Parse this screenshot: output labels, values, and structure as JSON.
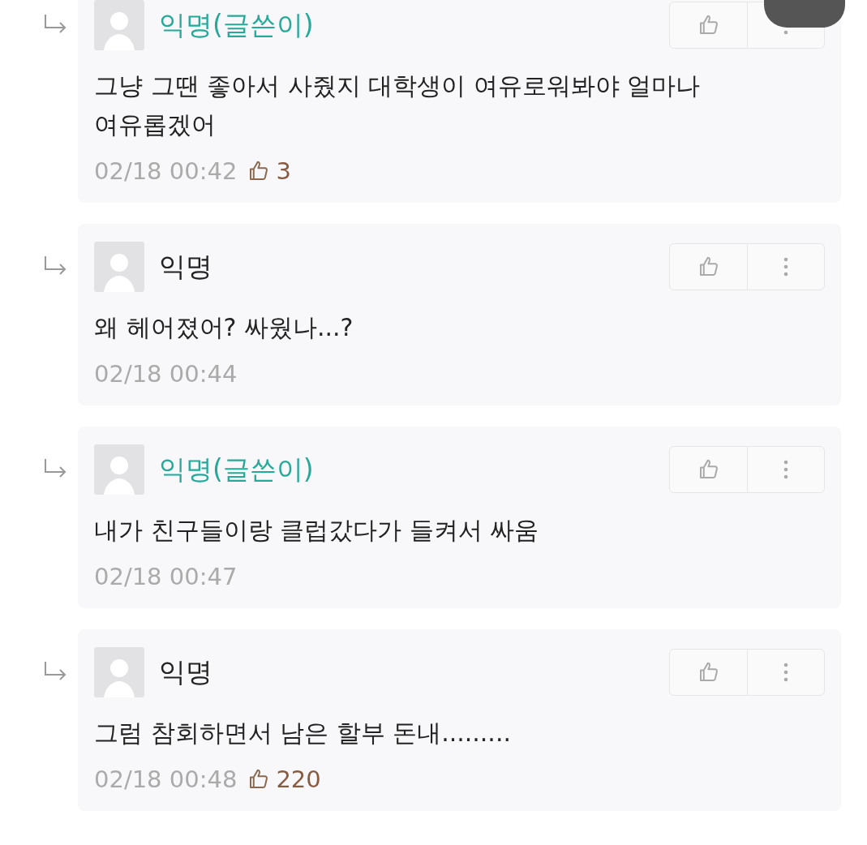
{
  "comments": [
    {
      "author": "익명(글쓴이)",
      "is_writer": true,
      "text": "그냥 그땐 좋아서 사줬지 대학생이 여유로워봐야 얼마나 여유롭겠어",
      "time": "02/18 00:42",
      "likes": "3"
    },
    {
      "author": "익명",
      "is_writer": false,
      "text": "왜 헤어졌어? 싸웠나...?",
      "time": "02/18 00:44"
    },
    {
      "author": "익명(글쓴이)",
      "is_writer": true,
      "text": "내가 친구들이랑 클럽갔다가 들켜서 싸움",
      "time": "02/18 00:47"
    },
    {
      "author": "익명",
      "is_writer": false,
      "text": "그럼 참회하면서 남은 할부 돈내.........",
      "time": "02/18 00:48",
      "likes": "220"
    }
  ]
}
